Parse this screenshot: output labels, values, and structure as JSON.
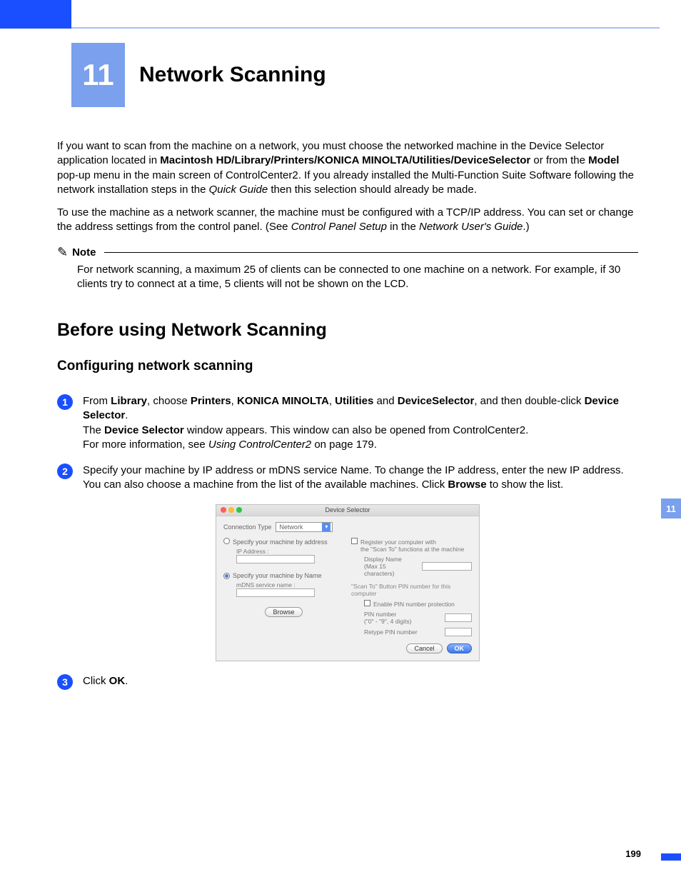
{
  "chapter": {
    "number": "11",
    "title": "Network Scanning"
  },
  "intro": {
    "p1_a": "If you want to scan from the machine on a network, you must choose the networked machine in the Device Selector application located in ",
    "p1_path": "Macintosh HD/Library/Printers/KONICA MINOLTA/Utilities/DeviceSelector",
    "p1_b": " or from the ",
    "p1_model": "Model",
    "p1_c": " pop-up menu in the main screen of ControlCenter2. If you already installed the Multi-Function Suite Software following the network installation steps in the ",
    "p1_quick": "Quick Guide",
    "p1_d": " then this selection should already be made.",
    "p2_a": "To use the machine as a network scanner, the machine must be configured with a TCP/IP address. You can set or change the address settings from the control panel. (See ",
    "p2_cps": "Control Panel Setup",
    "p2_b": " in the ",
    "p2_nug": "Network User's Guide",
    "p2_c": ".)"
  },
  "note": {
    "label": "Note",
    "body": "For network scanning, a maximum 25 of clients can be connected to one machine on a network. For example, if 30 clients try to connect at a time, 5 clients will not be shown on the LCD."
  },
  "sections": {
    "before": "Before using Network Scanning",
    "config": "Configuring network scanning"
  },
  "steps": {
    "s1": {
      "num": "1",
      "a": "From ",
      "lib": "Library",
      "b": ", choose ",
      "pr": "Printers",
      "c": ", ",
      "km": "KONICA MINOLTA",
      "d": ", ",
      "ut": "Utilities",
      "e": " and ",
      "ds": "DeviceSelector",
      "f": ", and then double-click ",
      "ds2": "Device Selector",
      "g": ".",
      "line2a": "The ",
      "line2b": "Device Selector",
      "line2c": " window appears. This window can also be opened from ControlCenter2.",
      "line3a": "For more information, see ",
      "line3i": "Using ControlCenter2",
      "line3b": " on page 179."
    },
    "s2": {
      "num": "2",
      "a": "Specify your machine by IP address or mDNS service Name. To change the IP address, enter the new IP address. You can also choose a machine from the list of the available machines. Click ",
      "browse": "Browse",
      "b": " to show the list."
    },
    "s3": {
      "num": "3",
      "a": "Click ",
      "ok": "OK",
      "b": "."
    }
  },
  "dialog": {
    "title": "Device Selector",
    "conn_type_label": "Connection Type",
    "conn_type_value": "Network",
    "by_addr": "Specify your machine by address",
    "ip_label": "IP Address :",
    "by_name": "Specify your machine by Name",
    "mdns_label": "mDNS service name :",
    "browse": "Browse",
    "register_a": "Register your computer with",
    "register_b": "the \"Scan To\" functions at the machine",
    "display_name": "Display Name",
    "max_chars": "(Max 15 characters)",
    "scanto_header": "\"Scan To\" Button PIN number for this computer",
    "enable_pin": "Enable PIN number protection",
    "pin_label": "PIN number",
    "pin_hint": "(\"0\" - \"9\", 4 digits)",
    "retype_pin": "Retype PIN number",
    "cancel": "Cancel",
    "ok": "OK"
  },
  "sidetab": "11",
  "page_number": "199"
}
